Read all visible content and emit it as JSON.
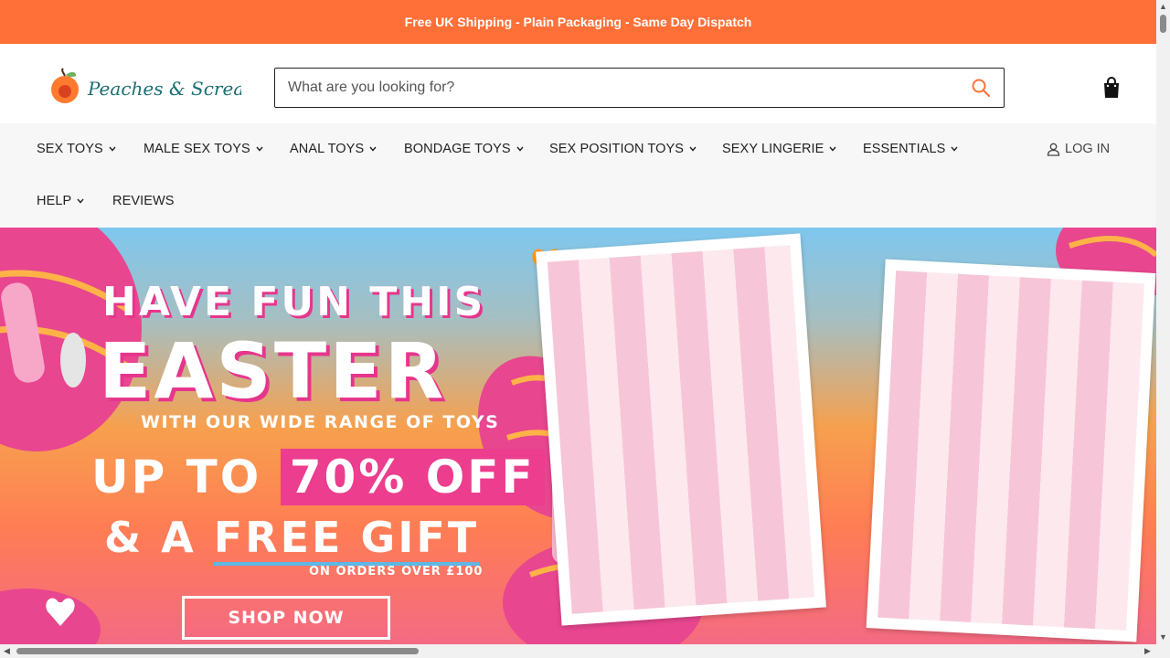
{
  "announcement": "Free UK Shipping - Plain Packaging - Same Day Dispatch",
  "brand": {
    "logo_text": "Peaches & Screams",
    "accent": "#ff7039",
    "logo_text_color": "#1a6e73"
  },
  "search": {
    "placeholder": "What are you looking for?"
  },
  "nav": {
    "row1": [
      "SEX TOYS",
      "MALE SEX TOYS",
      "ANAL TOYS",
      "BONDAGE TOYS",
      "SEX POSITION TOYS",
      "SEXY LINGERIE",
      "ESSENTIALS"
    ],
    "row2": [
      "HELP",
      "REVIEWS"
    ],
    "login": "LOG IN"
  },
  "hero": {
    "line1": "HAVE FUN THIS",
    "line2": "EASTER",
    "line3": "WITH OUR WIDE RANGE OF TOYS",
    "line4_prefix": "UP TO",
    "line4_highlight": "70% OFF",
    "line5_prefix": "& A",
    "line5_highlight": "FREE GIFT",
    "line6": "ON ORDERS OVER £100",
    "cta": "SHOP NOW",
    "pink": "#ec3d8e"
  },
  "icons": [
    "search-icon",
    "shopping-bag-icon",
    "chevron-down-icon",
    "user-icon"
  ]
}
